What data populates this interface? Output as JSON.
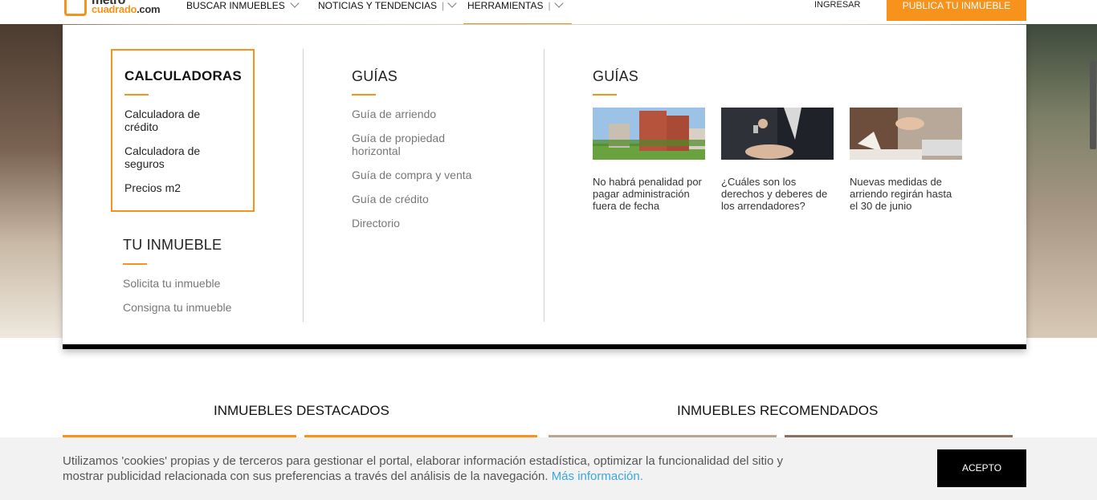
{
  "header": {
    "logo_top": "metro",
    "logo_bottom": "cuadrado",
    "logo_tld": ".com",
    "nav": [
      {
        "label": "BUSCAR INMUEBLES"
      },
      {
        "label": "NOTICIAS Y TENDENCIAS"
      },
      {
        "label": "HERRAMIENTAS"
      }
    ],
    "login": "INGRESAR",
    "publish": "PUBLICA TU INMUEBLE"
  },
  "menu": {
    "calculadoras": {
      "title": "CALCULADORAS",
      "items": [
        "Calculadora de crédito",
        "Calculadora de seguros",
        "Precios m2"
      ]
    },
    "tu_inmueble": {
      "title": "TU INMUEBLE",
      "items": [
        "Solicita tu inmueble",
        "Consigna tu inmueble"
      ]
    },
    "guias": {
      "title": "GUÍAS",
      "items": [
        "Guía de arriendo",
        "Guía de propiedad horizontal",
        "Guía de compra y venta",
        "Guía de crédito",
        "Directorio"
      ]
    },
    "guias_news": {
      "title": "GUÍAS",
      "articles": [
        {
          "caption": "No habrá penalidad por pagar administración fuera de fecha"
        },
        {
          "caption": "¿Cuáles son los derechos y deberes de los arrendadores?"
        },
        {
          "caption": "Nuevas medidas de arriendo regirán hasta el 30 de junio"
        }
      ]
    }
  },
  "sections": {
    "featured": "INMUEBLES DESTACADOS",
    "recommended": "INMUEBLES RECOMENDADOS"
  },
  "cookie": {
    "text": "Utilizamos 'cookies' propias y de terceros para gestionar el portal, elaborar información estadística, optimizar la funcionalidad del sitio y mostrar publicidad relacionada con sus preferencias a través del análisis de la navegación.",
    "link": "Más información.",
    "accept": "ACEPTO"
  },
  "colors": {
    "accent": "#f7931d",
    "link": "#3ea6d8"
  }
}
